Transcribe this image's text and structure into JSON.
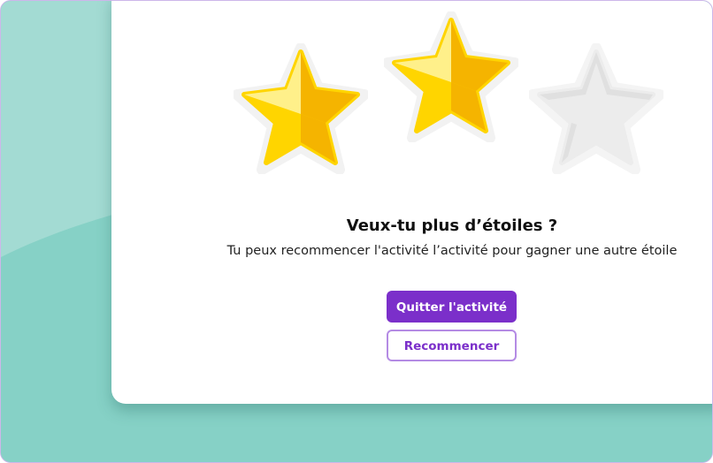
{
  "dialog": {
    "title": "Veux-tu plus d’étoiles ?",
    "message": "Tu peux recommencer l'activité l’activité pour gagner une autre étoile",
    "rating": {
      "earned": 2,
      "total": 3
    },
    "stars": [
      {
        "state": "earned",
        "icon": "star-filled-icon"
      },
      {
        "state": "earned",
        "icon": "star-filled-icon"
      },
      {
        "state": "empty",
        "icon": "star-empty-icon"
      }
    ]
  },
  "buttons": {
    "quit_label": "Quitter l'activité",
    "restart_label": "Recommencer"
  },
  "colors": {
    "background_teal": "#86d1c6",
    "background_light": "#a3dbd3",
    "accent_purple": "#7b2fca",
    "accent_purple_border": "#b48be4",
    "star_gold": "#ffd500",
    "star_gold_light": "#fff08a",
    "star_gold_dark": "#f5b400",
    "star_empty": "#ececec",
    "star_empty_shade": "#e2e2e2"
  }
}
